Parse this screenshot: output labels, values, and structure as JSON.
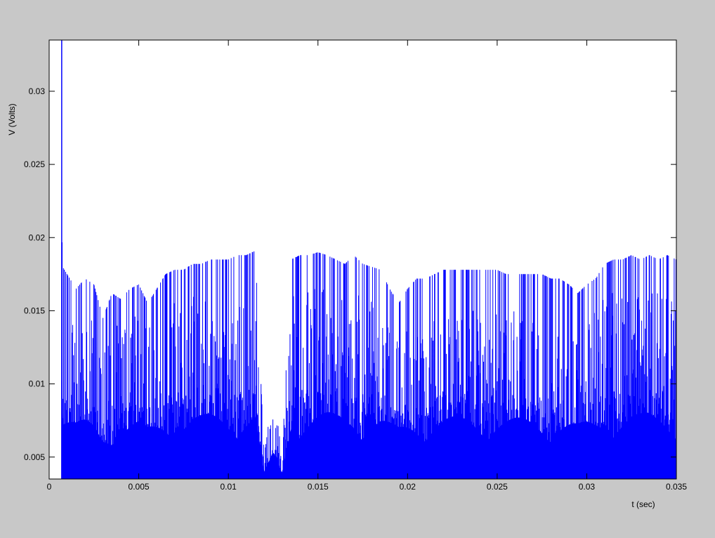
{
  "figure": {
    "background": "#c8c8c8",
    "axes_background": "#ffffff"
  },
  "chart_data": {
    "type": "line",
    "title": "",
    "xlabel": "t (sec)",
    "ylabel": "V (Volts)",
    "xlim": [
      0,
      0.035
    ],
    "ylim": [
      0.0035,
      0.0335
    ],
    "xticks": [
      0,
      0.005,
      0.01,
      0.015,
      0.02,
      0.025,
      0.03,
      0.035
    ],
    "xtick_labels": [
      "0",
      "0.005",
      "0.01",
      "0.015",
      "0.02",
      "0.025",
      "0.03",
      "0.035"
    ],
    "yticks": [
      0.005,
      0.01,
      0.015,
      0.02,
      0.025,
      0.03
    ],
    "ytick_labels": [
      "0.005",
      "0.01",
      "0.015",
      "0.02",
      "0.025",
      "0.03"
    ],
    "grid": false,
    "line_color": "#0000ff",
    "series": [
      {
        "description": "rapidly oscillating signal; envelope of peak values sampled along t",
        "x": [
          0.0007,
          0.00072,
          0.00075,
          0.001,
          0.0015,
          0.002,
          0.0025,
          0.003,
          0.0035,
          0.004,
          0.0045,
          0.005,
          0.0055,
          0.006,
          0.0065,
          0.007,
          0.0075,
          0.008,
          0.0085,
          0.009,
          0.0095,
          0.01,
          0.0105,
          0.011,
          0.0115,
          0.012,
          0.0125,
          0.013,
          0.0135,
          0.014,
          0.0145,
          0.015,
          0.0155,
          0.016,
          0.0165,
          0.017,
          0.0175,
          0.018,
          0.0185,
          0.019,
          0.0195,
          0.02,
          0.0205,
          0.021,
          0.0215,
          0.022,
          0.0225,
          0.023,
          0.0235,
          0.024,
          0.0245,
          0.025,
          0.0255,
          0.026,
          0.0265,
          0.027,
          0.0275,
          0.028,
          0.0285,
          0.029,
          0.0295,
          0.03,
          0.0305,
          0.031,
          0.0315,
          0.032,
          0.0325,
          0.033,
          0.0335,
          0.034,
          0.0345,
          0.035
        ],
        "peak": [
          0.0335,
          0.0235,
          0.018,
          0.0175,
          0.0165,
          0.0172,
          0.0168,
          0.0145,
          0.0162,
          0.0158,
          0.0165,
          0.0168,
          0.0155,
          0.0165,
          0.0175,
          0.0178,
          0.0178,
          0.0182,
          0.0182,
          0.0185,
          0.0185,
          0.0185,
          0.0188,
          0.0188,
          0.0191,
          0.005,
          0.0098,
          0.005,
          0.0185,
          0.0188,
          0.0188,
          0.019,
          0.0188,
          0.0185,
          0.0182,
          0.0188,
          0.0182,
          0.018,
          0.0178,
          0.0165,
          0.0155,
          0.0165,
          0.0172,
          0.0172,
          0.0175,
          0.0178,
          0.0178,
          0.0178,
          0.0178,
          0.0178,
          0.0178,
          0.0178,
          0.0175,
          0.0175,
          0.0175,
          0.0175,
          0.0175,
          0.0172,
          0.0172,
          0.0168,
          0.0162,
          0.0168,
          0.0172,
          0.0182,
          0.0185,
          0.0185,
          0.0188,
          0.0185,
          0.0188,
          0.0185,
          0.0188,
          0.0185
        ]
      }
    ]
  }
}
